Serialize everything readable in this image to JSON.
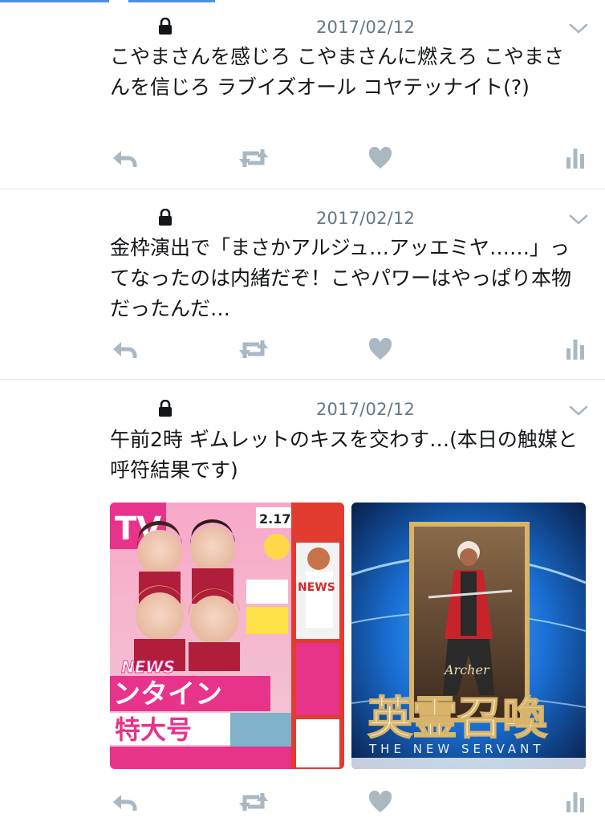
{
  "tweets": [
    {
      "date": "2017/02/12",
      "text": "こやまさんを感じろ こやまさんに燃えろ こやまさんを信じろ ラブイズオール コヤテッナイト(?)"
    },
    {
      "date": "2017/02/12",
      "text": "金枠演出で「まさかアルジュ…アッエミヤ……」ってなったのは内緒だぞ！こやパワーはやっぱり本物だったんだ…"
    },
    {
      "date": "2017/02/12",
      "text": "午前2時 ギムレットのキスを交わす…(本日の触媒と呼符結果です)",
      "media": {
        "magazine": {
          "masthead": "TV",
          "date_label": "2.17",
          "group_label": "NEWS",
          "headline_lines": [
            "ンタイン",
            "特大号"
          ],
          "spine_label": "NEWS"
        },
        "summon": {
          "class_label": "Archer",
          "title": "英霊召喚",
          "subtitle": "THE NEW SERVANT"
        }
      }
    }
  ],
  "colors": {
    "icon_gray": "#aab8c2",
    "date_gray": "#657786",
    "divider": "#e1e8ed",
    "top_accent": "#4a90e2",
    "magazine_pink": "#e8338a",
    "summon_blue": "#1a6fd4",
    "summon_gold": "#d7b46a"
  },
  "icons": [
    "lock-icon",
    "chevron-down-icon",
    "reply-icon",
    "retweet-icon",
    "like-icon",
    "analytics-icon"
  ]
}
